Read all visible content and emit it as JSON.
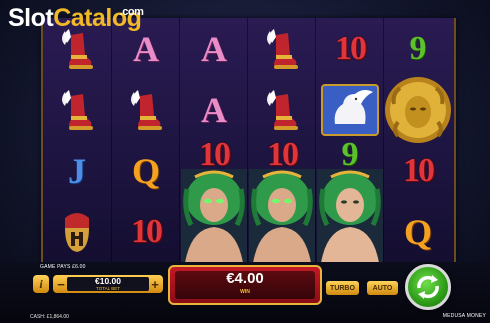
{
  "watermark": {
    "part1": "Slot",
    "part2": "Catalog",
    "suffix": ".com"
  },
  "reels": [
    [
      "winged-sandal",
      "winged-sandal",
      "J",
      "spartan-helmet"
    ],
    [
      "A",
      "winged-sandal",
      "Q",
      "10"
    ],
    [
      "A",
      "A",
      "10",
      "medusa"
    ],
    [
      "winged-sandal",
      "winged-sandal",
      "10",
      "medusa"
    ],
    [
      "10",
      "pegasus",
      "9",
      "medusa"
    ],
    [
      "9",
      "medusa-coin",
      "10",
      "Q"
    ]
  ],
  "symbols": {
    "ten": "10",
    "nine": "9",
    "ace": "A",
    "queen": "Q",
    "jack": "J"
  },
  "controls": {
    "game_pays": "GAME PAYS £6.00",
    "info": "i",
    "bet_minus": "−",
    "bet_plus": "+",
    "bet_value": "€10.00",
    "bet_label": "TOTAL BET",
    "win_value": "€4.00",
    "win_label": "WIN",
    "turbo": "TURBO",
    "auto": "AUTO",
    "cash_label": "CASH:",
    "cash_value": "£1,864.00",
    "game_title": "MEDUSA MONEY"
  },
  "colors": {
    "ten": "#e0353a",
    "nine": "#5cc22a",
    "ace": "#e88dc7",
    "queen": "#f4a021",
    "jack": "#4c8ee8",
    "spin": "#2e9c18",
    "win_panel": "#c21a26"
  }
}
